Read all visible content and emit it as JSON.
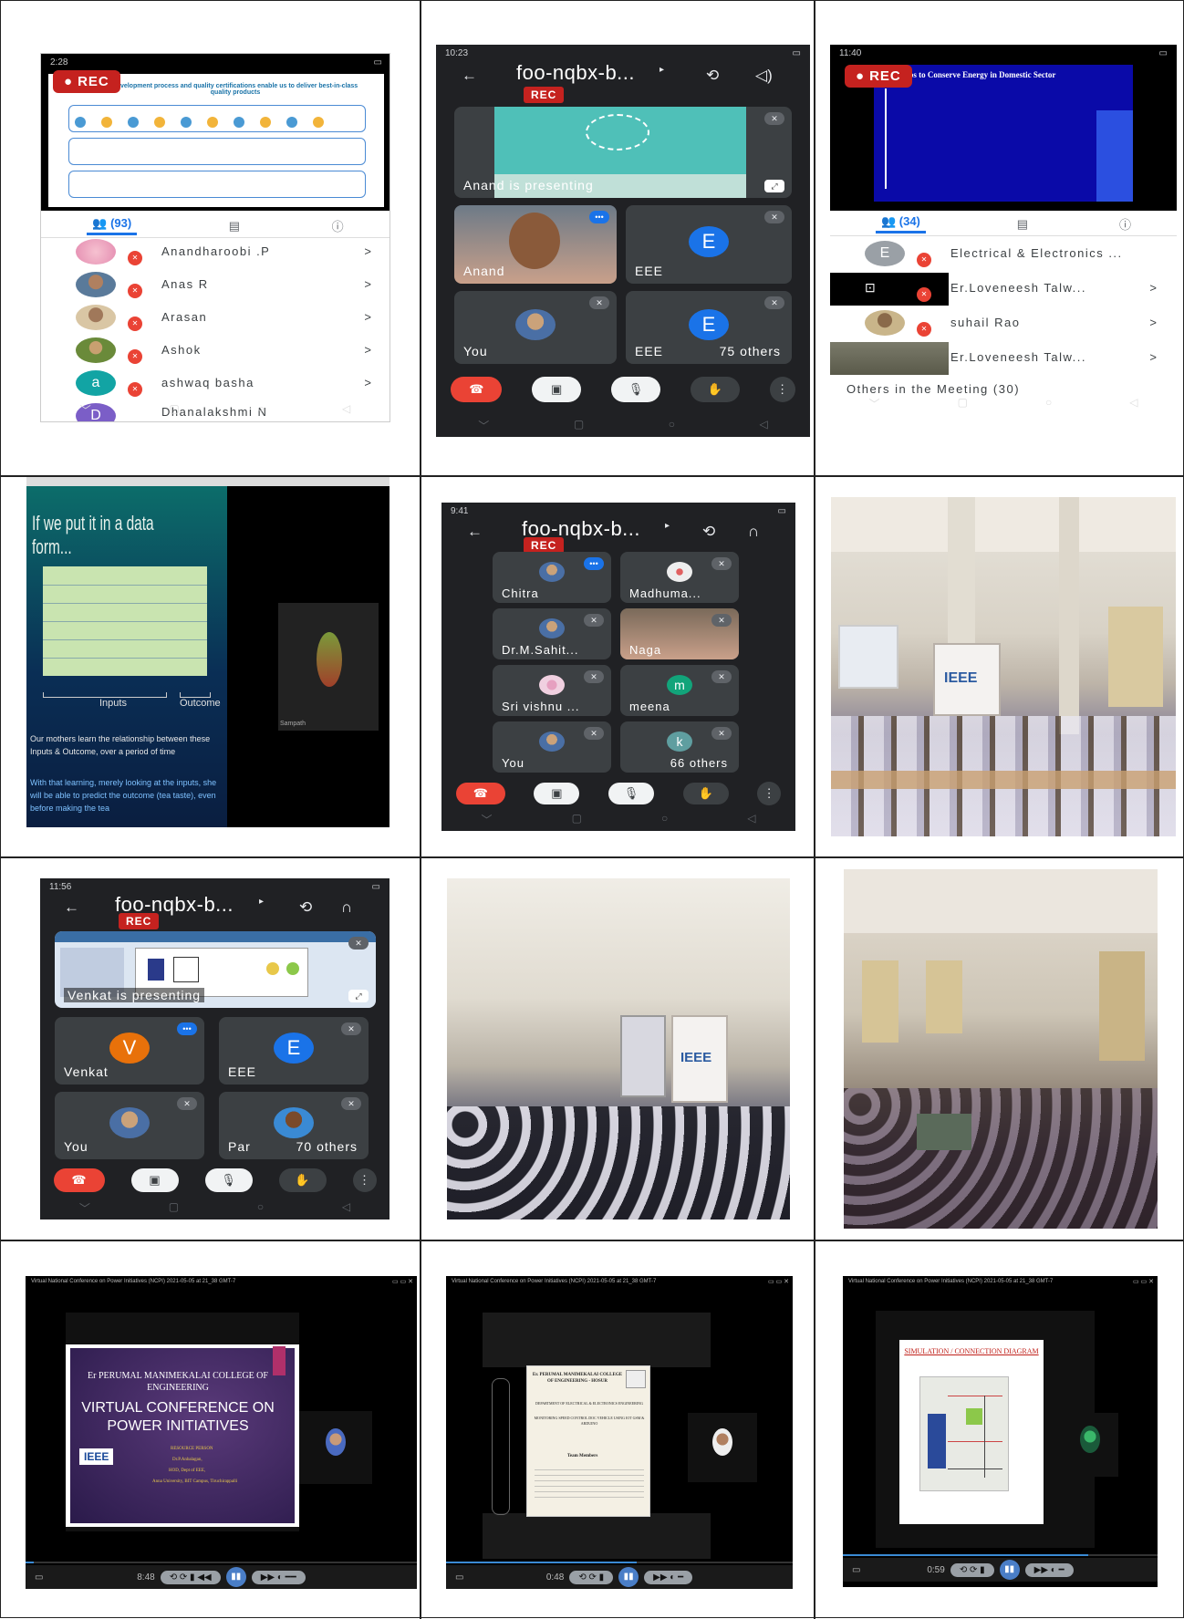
{
  "p1": {
    "status_time": "2:28",
    "rec": "REC",
    "slide_title": "development process and quality certifications enable us to deliver best-in-class quality products",
    "tab_count": "(93)",
    "participants": [
      {
        "name": "Anandharoobi .P"
      },
      {
        "name": "Anas R"
      },
      {
        "name": "Arasan"
      },
      {
        "name": "Ashok"
      },
      {
        "name": "ashwaq basha",
        "initial": "a"
      },
      {
        "name": "Dhanalakshmi N",
        "initial": "D"
      }
    ]
  },
  "p2": {
    "status_time": "10:23",
    "meeting": "foo-nqbx-b...",
    "rec": "REC",
    "presenting": "Anand is presenting",
    "tiles": [
      {
        "name": "Anand"
      },
      {
        "name": "EEE",
        "initial": "E"
      },
      {
        "name": "You"
      },
      {
        "name": "EEE",
        "initial": "E"
      }
    ],
    "others": "75 others"
  },
  "p3": {
    "status_time": "11:40",
    "rec": "REC",
    "slide_title": "Tips to Conserve Energy in Domestic Sector",
    "tab_count": "(34)",
    "participants": [
      {
        "name": "Electrical & Electronics ...",
        "initial": "E"
      },
      {
        "name": "Er.Loveneesh Talw..."
      },
      {
        "name": "suhail Rao"
      },
      {
        "name": "Er.Loveneesh Talw..."
      }
    ],
    "others_heading": "Others in the Meeting (30)"
  },
  "p4": {
    "heading": "If we put it in a data form...",
    "label_inputs": "Inputs",
    "label_outcome": "Outcome",
    "para1": "Our mothers learn the relationship between these Inputs & Outcome, over a period of time",
    "para2": "With that learning, merely looking at the inputs, she will be able to predict the outcome (tea taste), even before making the tea",
    "thumb_name": "Sampath"
  },
  "p5": {
    "status_time": "9:41",
    "meeting": "foo-nqbx-b...",
    "rec": "REC",
    "tiles": [
      {
        "name": "Chitra"
      },
      {
        "name": "Madhuma..."
      },
      {
        "name": "Dr.M.Sahit..."
      },
      {
        "name": "Naga"
      },
      {
        "name": "Sri vishnu ..."
      },
      {
        "name": "meena",
        "initial": "m"
      },
      {
        "name": "You"
      },
      {
        "name": "k",
        "initial": "k"
      }
    ],
    "others": "66 others"
  },
  "p6": {
    "banner": "IEEE"
  },
  "p7": {
    "status_time": "11:56",
    "meeting": "foo-nqbx-b...",
    "rec": "REC",
    "presenting": "Venkat is presenting",
    "tiles": [
      {
        "name": "Venkat",
        "initial": "V"
      },
      {
        "name": "EEE",
        "initial": "E"
      },
      {
        "name": "You"
      },
      {
        "name": "Par"
      }
    ],
    "others": "70 others"
  },
  "p8": {
    "banner": "IEEE"
  },
  "p10": {
    "window_title": "Virtual National Conference on Power Initiatives (NCPI) 2021-05-05 at 21_38 GMT-7",
    "college": "Er PERUMAL MANIMEKALAI COLLEGE OF ENGINEERING",
    "conf": "VIRTUAL CONFERENCE ON POWER INITIATIVES",
    "ieee": "IEEE",
    "resource": "RESOURCE PERSON",
    "person": "Dr.P.Anbalagan,",
    "dept": "HOD, Dept of EEE,",
    "univ": "Anna University, BIT Campus, Tiruchirappalli",
    "time": "8:48"
  },
  "p11": {
    "window_title": "Virtual National Conference on Power Initiatives (NCPI) 2021-05-05 at 21_38 GMT-7",
    "college": "Er. PERUMAL MANIMEKALAI COLLEGE OF ENGINEERING - HOSUR",
    "dept": "DEPARTMENT OF ELECTRICAL & ELECTRONICS ENGINEERING",
    "project": "MONITORING SPEED CONTROL DOC VEHICLE USING IOT GSM & ARDUINO",
    "team": "Team Members",
    "time": "0:48"
  },
  "p12": {
    "window_title": "Virtual National Conference on Power Initiatives (NCPI) 2021-05-05 at 21_38 GMT-7",
    "diagram_title": "SIMULATION / CONNECTION DIAGRAM",
    "time": "0:59"
  }
}
